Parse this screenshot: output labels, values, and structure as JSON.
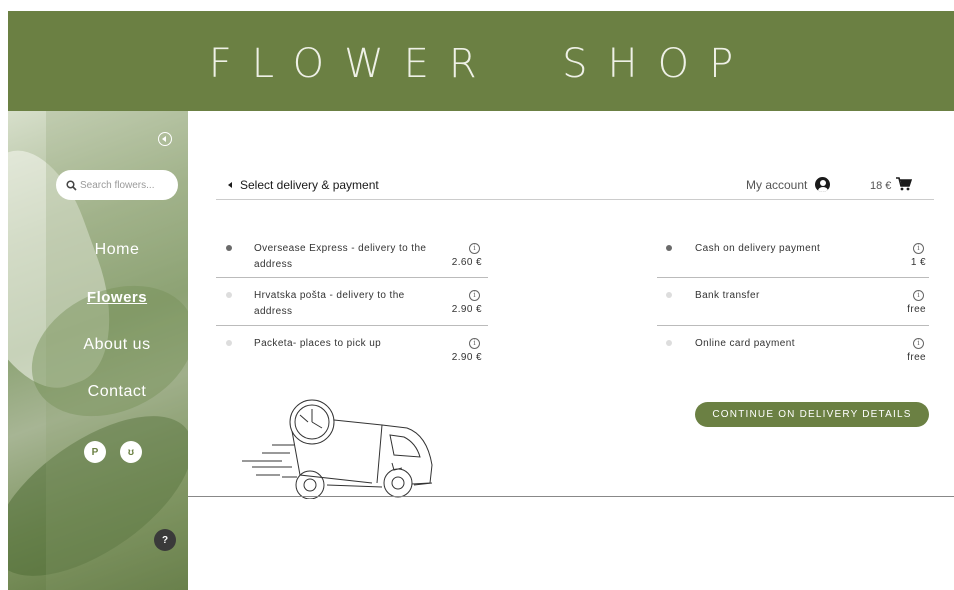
{
  "header": {
    "title": "FLOWER  SHOP"
  },
  "sidebar": {
    "search_placeholder": "Search flowers...",
    "nav": [
      {
        "label": "Home",
        "active": false
      },
      {
        "label": "Flowers",
        "active": true
      },
      {
        "label": "About us",
        "active": false
      },
      {
        "label": "Contact",
        "active": false
      }
    ],
    "languages": [
      "P",
      "ʊ"
    ],
    "help": "?"
  },
  "topbar": {
    "back_label": "Select delivery & payment",
    "account_label": "My account",
    "cart_total": "18 €"
  },
  "delivery": [
    {
      "label": "Oversease Express - delivery to the address",
      "price": "2.60 €",
      "selected": true
    },
    {
      "label": "Hrvatska pošta - delivery to the address",
      "price": "2.90 €",
      "selected": false
    },
    {
      "label": "Packeta- places to pick up",
      "price": "2.90 €",
      "selected": false
    }
  ],
  "payment": [
    {
      "label": "Cash on delivery payment",
      "price": "1 €",
      "selected": true
    },
    {
      "label": "Bank transfer",
      "price": "free",
      "selected": false
    },
    {
      "label": "Online card payment",
      "price": "free",
      "selected": false
    }
  ],
  "continue_label": "CONTINUE ON DELIVERY DETAILS",
  "colors": {
    "brand": "#6b8043",
    "header_text": "#eef0e6"
  },
  "icons": [
    "collapse-icon",
    "search-icon",
    "account-icon",
    "cart-icon",
    "info-icon",
    "delivery-truck-illustration"
  ]
}
